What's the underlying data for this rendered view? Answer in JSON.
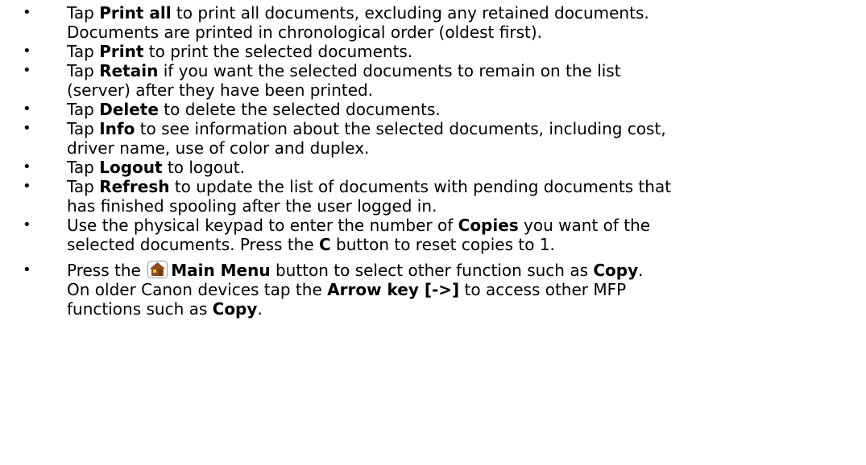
{
  "bullet_char": "•",
  "items": [
    {
      "lines": [
        [
          {
            "t": "Tap "
          },
          {
            "t": "Print all",
            "b": true
          },
          {
            "t": " to print all documents, excluding any retained documents."
          }
        ],
        [
          {
            "t": "Documents are printed in chronological order (oldest first)."
          }
        ]
      ]
    },
    {
      "lines": [
        [
          {
            "t": "Tap "
          },
          {
            "t": "Print",
            "b": true
          },
          {
            "t": " to print the selected documents."
          }
        ]
      ]
    },
    {
      "lines": [
        [
          {
            "t": "Tap "
          },
          {
            "t": "Retain",
            "b": true
          },
          {
            "t": " if you want the selected documents to remain on the list"
          }
        ],
        [
          {
            "t": "(server) after they have been printed."
          }
        ]
      ]
    },
    {
      "lines": [
        [
          {
            "t": "Tap "
          },
          {
            "t": "Delete",
            "b": true
          },
          {
            "t": " to delete the selected documents."
          }
        ]
      ]
    },
    {
      "lines": [
        [
          {
            "t": "Tap "
          },
          {
            "t": "Info",
            "b": true
          },
          {
            "t": " to see information about the selected documents, including cost,"
          }
        ],
        [
          {
            "t": "driver name, use of color and duplex."
          }
        ]
      ]
    },
    {
      "lines": [
        [
          {
            "t": "Tap "
          },
          {
            "t": "Logout",
            "b": true
          },
          {
            "t": " to logout."
          }
        ]
      ]
    },
    {
      "lines": [
        [
          {
            "t": "Tap "
          },
          {
            "t": "Refresh",
            "b": true
          },
          {
            "t": " to update the list of documents with pending documents that"
          }
        ],
        [
          {
            "t": "has finished spooling after the user logged in."
          }
        ]
      ]
    },
    {
      "lines": [
        [
          {
            "t": "Use the physical keypad to enter the number of "
          },
          {
            "t": "Copies",
            "b": true
          },
          {
            "t": " you want of the"
          }
        ],
        [
          {
            "t": "selected documents. Press the "
          },
          {
            "t": "C",
            "b": true
          },
          {
            "t": " button to reset copies to 1."
          }
        ]
      ]
    },
    {
      "gap": true,
      "lines": [
        [
          {
            "t": "Press the "
          },
          {
            "icon": "home-icon"
          },
          {
            "t": "Main Menu",
            "b": true
          },
          {
            "t": " button to select other function such as "
          },
          {
            "t": "Copy",
            "b": true
          },
          {
            "t": "."
          }
        ],
        [
          {
            "t": "On older Canon devices tap the "
          },
          {
            "t": "Arrow key [->]",
            "b": true
          },
          {
            "t": " to access other MFP"
          }
        ],
        [
          {
            "t": "functions such as "
          },
          {
            "t": "Copy",
            "b": true
          },
          {
            "t": "."
          }
        ]
      ]
    }
  ],
  "colors": {
    "text": "#000000",
    "icon_house": "#6b3a1a",
    "icon_roof": "#8a4a20",
    "icon_window": "#f4c542"
  }
}
